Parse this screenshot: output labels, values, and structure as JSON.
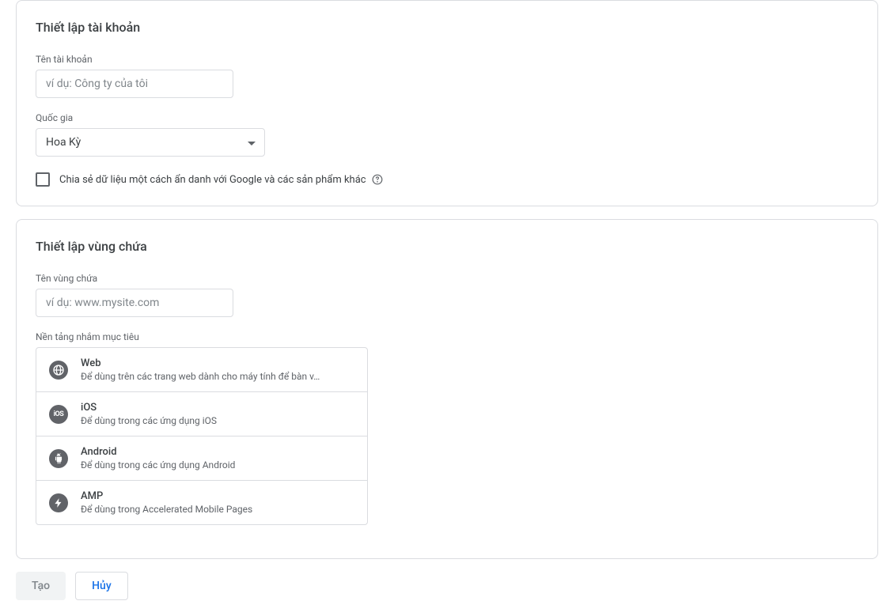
{
  "account_setup": {
    "title": "Thiết lập tài khoản",
    "name_label": "Tên tài khoản",
    "name_placeholder": "ví dụ: Công ty của tôi",
    "country_label": "Quốc gia",
    "country_value": "Hoa Kỳ",
    "share_data_label": "Chia sẻ dữ liệu một cách ẩn danh với Google và các sản phẩm khác"
  },
  "container_setup": {
    "title": "Thiết lập vùng chứa",
    "name_label": "Tên vùng chứa",
    "name_placeholder": "ví dụ: www.mysite.com",
    "platform_label": "Nền tảng nhắm mục tiêu",
    "platforms": [
      {
        "title": "Web",
        "desc": "Để dùng trên các trang web dành cho máy tính để bàn v…"
      },
      {
        "title": "iOS",
        "desc": "Để dùng trong các ứng dụng iOS"
      },
      {
        "title": "Android",
        "desc": "Để dùng trong các ứng dụng Android"
      },
      {
        "title": "AMP",
        "desc": "Để dùng trong Accelerated Mobile Pages"
      }
    ]
  },
  "actions": {
    "create": "Tạo",
    "cancel": "Hủy"
  }
}
